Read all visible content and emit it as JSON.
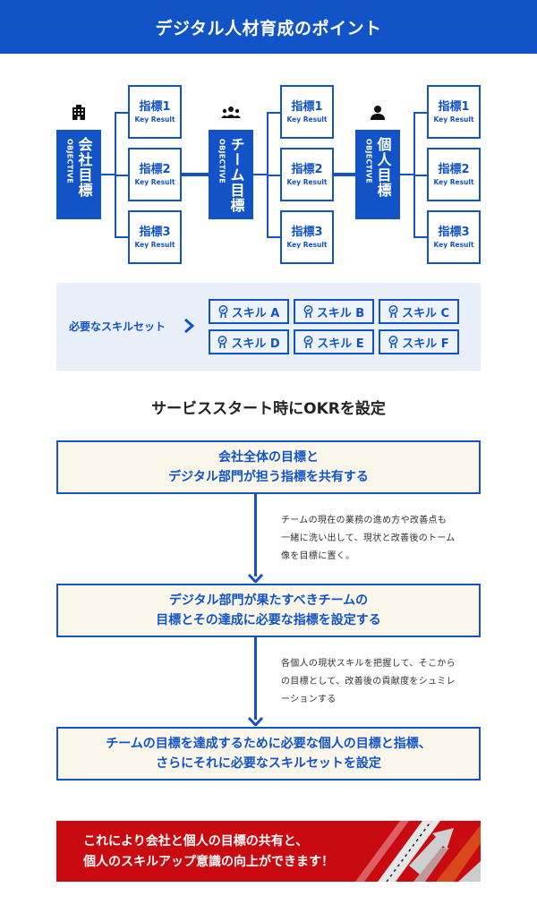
{
  "header": {
    "title": "デジタル人材育成のポイント"
  },
  "okr": {
    "objectives": [
      {
        "label": "会社目標",
        "sub": "OBJECTIVE",
        "icon": "building-icon"
      },
      {
        "label": "チーム目標",
        "sub": "OBJECTIVE",
        "icon": "team-icon"
      },
      {
        "label": "個人目標",
        "sub": "OBJECTIVE",
        "icon": "person-icon"
      }
    ],
    "key_results": [
      {
        "title": "指標1",
        "sub": "Key Result"
      },
      {
        "title": "指標2",
        "sub": "Key Result"
      },
      {
        "title": "指標3",
        "sub": "Key Result"
      }
    ]
  },
  "skills": {
    "label": "必要なスキルセット",
    "items": [
      "スキル A",
      "スキル B",
      "スキル C",
      "スキル D",
      "スキル E",
      "スキル F"
    ]
  },
  "flow": {
    "title": "サービススタート時にOKRを設定",
    "steps": [
      {
        "lines": [
          "会社全体の目標と",
          "デジタル部門が担う指標を共有する"
        ]
      },
      {
        "lines": [
          "デジタル部門が果たすべきチームの",
          "目標とその達成に必要な指標を設定する"
        ]
      },
      {
        "lines": [
          "チームの目標を達成するために必要な個人の目標と指標、",
          "さらにそれに必要なスキルセットを設定"
        ]
      }
    ],
    "notes": [
      {
        "lines": [
          "チームの現在の業務の進め方や改善点も",
          "一緒に洗い出して、現状と改善後のトーム",
          "像を目標に置く。"
        ]
      },
      {
        "lines": [
          "各個人の現状スキルを把握して、そこから",
          "の目標として、改善後の貢献度をシュミレ",
          "ーションする"
        ]
      }
    ]
  },
  "banner": {
    "lines": [
      "これにより会社と個人の目標の共有と、",
      "個人のスキルアップ意識の向上ができます！"
    ]
  },
  "colors": {
    "primary": "#1254c8",
    "step_bg": "#faf6ea",
    "skills_bg": "#e8eff9",
    "banner_red": "#c90a10"
  }
}
